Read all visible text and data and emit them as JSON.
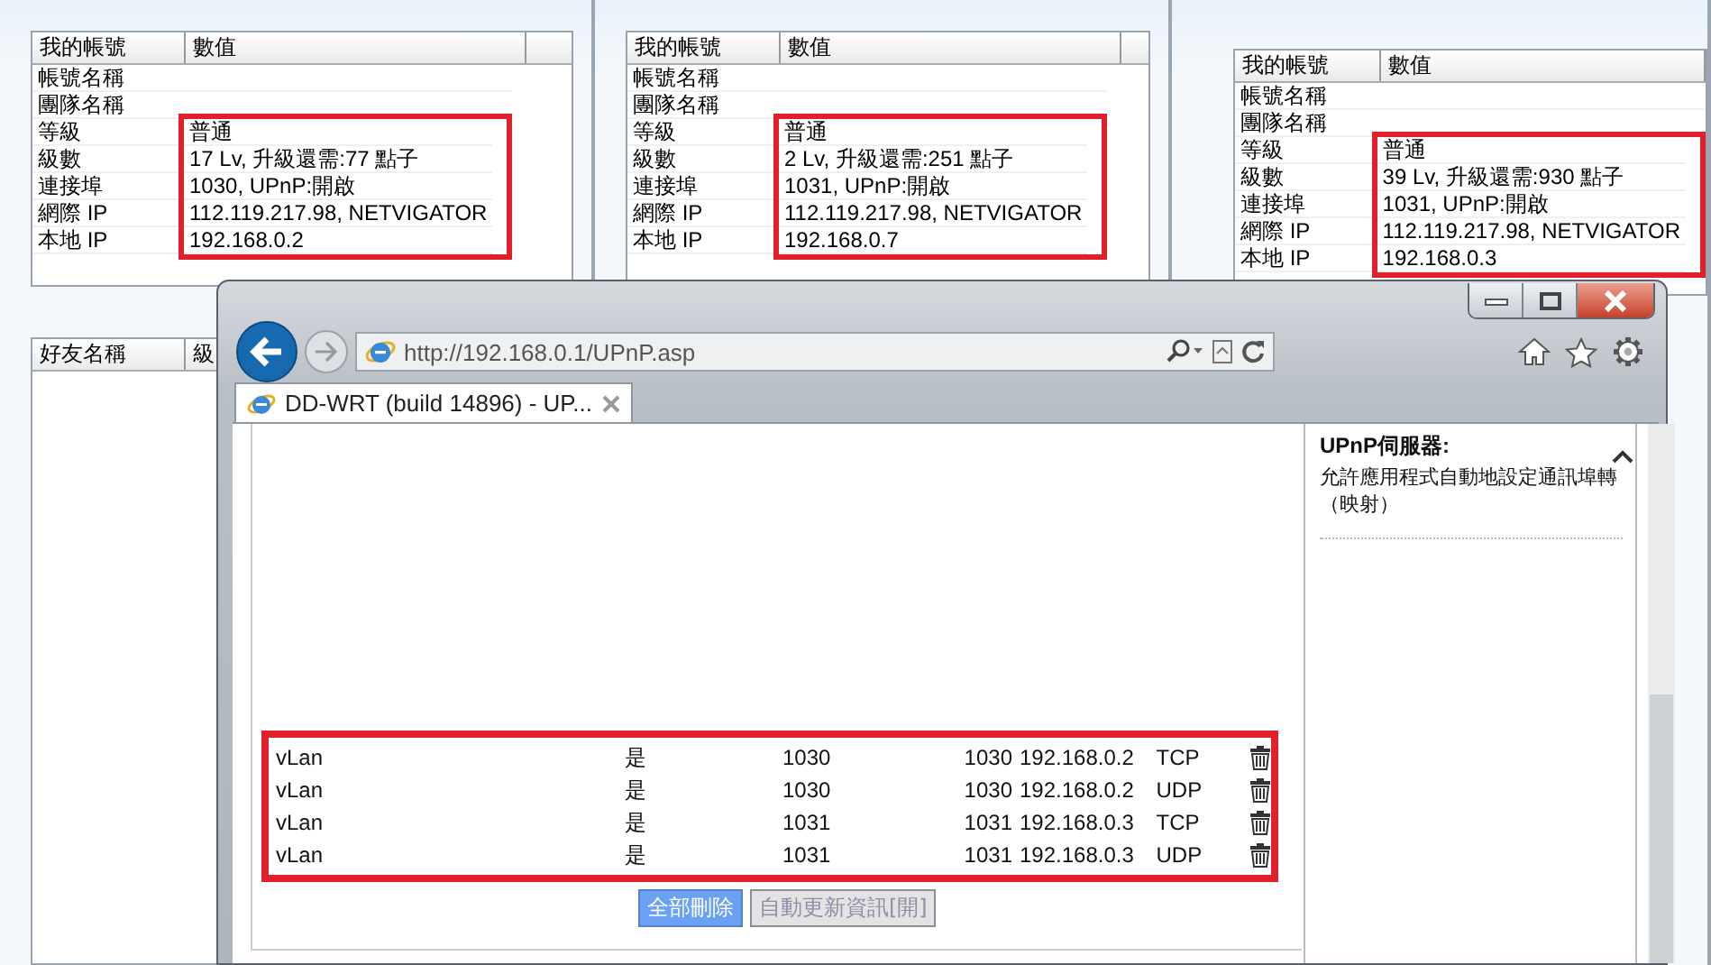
{
  "panels": [
    {
      "columns": [
        "我的帳號",
        "數值"
      ],
      "rows": [
        {
          "label": "帳號名稱",
          "highlighted": false
        },
        {
          "label": "團隊名稱",
          "highlighted": false
        },
        {
          "label": "等級",
          "value": "普通",
          "highlighted": true
        },
        {
          "label": "級數",
          "value": "17 Lv, 升級還需:77 點子",
          "highlighted": true
        },
        {
          "label": "連接埠",
          "value": "1030, UPnP:開啟",
          "highlighted": true
        },
        {
          "label": "網際 IP",
          "value": "112.119.217.98, NETVIGATOR",
          "highlighted": true
        },
        {
          "label": "本地 IP",
          "value": "192.168.0.2",
          "highlighted": true
        }
      ],
      "friends_columns": [
        "好友名稱",
        "級"
      ]
    },
    {
      "columns": [
        "我的帳號",
        "數值"
      ],
      "rows": [
        {
          "label": "帳號名稱",
          "highlighted": false
        },
        {
          "label": "團隊名稱",
          "highlighted": false
        },
        {
          "label": "等級",
          "value": "普通",
          "highlighted": true
        },
        {
          "label": "級數",
          "value": "2 Lv, 升級還需:251 點子",
          "highlighted": true
        },
        {
          "label": "連接埠",
          "value": "1031, UPnP:開啟",
          "highlighted": true
        },
        {
          "label": "網際 IP",
          "value": "112.119.217.98, NETVIGATOR",
          "highlighted": true
        },
        {
          "label": "本地 IP",
          "value": "192.168.0.7",
          "highlighted": true
        }
      ]
    },
    {
      "columns": [
        "我的帳號",
        "數值"
      ],
      "rows": [
        {
          "label": "帳號名稱",
          "highlighted": false
        },
        {
          "label": "團隊名稱",
          "highlighted": false
        },
        {
          "label": "等級",
          "value": "普通",
          "highlighted": true
        },
        {
          "label": "級數",
          "value": "39 Lv, 升級還需:930 點子",
          "highlighted": true
        },
        {
          "label": "連接埠",
          "value": "1031, UPnP:開啟",
          "highlighted": true
        },
        {
          "label": "網際 IP",
          "value": "112.119.217.98, NETVIGATOR",
          "highlighted": true
        },
        {
          "label": "本地 IP",
          "value": "192.168.0.3",
          "highlighted": true
        }
      ]
    }
  ],
  "browser": {
    "address": "http://192.168.0.1/UPnP.asp",
    "tabs": [
      {
        "label": "DD-WRT (build 14896) - UP...",
        "selected": true
      }
    ],
    "forwards_highlighted": true,
    "forwards": [
      {
        "name": "vLan",
        "enabled": "是",
        "port_from": "1030",
        "port_to": "1030",
        "ip": "192.168.0.2",
        "protocol": "TCP"
      },
      {
        "name": "vLan",
        "enabled": "是",
        "port_from": "1030",
        "port_to": "1030",
        "ip": "192.168.0.2",
        "protocol": "UDP"
      },
      {
        "name": "vLan",
        "enabled": "是",
        "port_from": "1031",
        "port_to": "1031",
        "ip": "192.168.0.3",
        "protocol": "TCP"
      },
      {
        "name": "vLan",
        "enabled": "是",
        "port_from": "1031",
        "port_to": "1031",
        "ip": "192.168.0.3",
        "protocol": "UDP"
      }
    ],
    "buttons": [
      {
        "label": "全部刪除",
        "disabled": false
      },
      {
        "label": "自動更新資訊[開]",
        "disabled": true
      }
    ],
    "help": {
      "title": "UPnP伺服器:",
      "text": "允許應用程式自動地設定通訊埠轉（映射）"
    }
  }
}
